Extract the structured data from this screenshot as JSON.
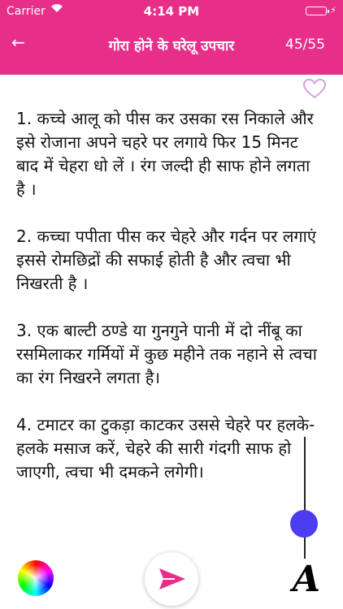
{
  "status_bar": {
    "carrier": "Carrier",
    "time": "4:14 PM"
  },
  "navbar": {
    "back_icon": "back-arrow-icon",
    "title": "गोरा होने के घरेलू उपचार",
    "counter": "45/55"
  },
  "colors": {
    "accent": "#e72f8a",
    "slider": "#4b3df0",
    "heart": "#d5a0e0"
  },
  "content": {
    "paragraphs": [
      "1. कच्चे आलू को पीस कर उसका रस निकाले और इसे रोजाना अपने चहरे पर लगाये फिर 15 मिनट बाद में चेहरा धो लें । रंग जल्दी ही साफ होने लगता है ।",
      "2. कच्चा पपीता पीस कर चेहरे और गर्दन पर लगाएं इससे रोमछिद्रों की सफाई होती है और त्वचा भी निखरती है ।",
      "3. एक बाल्टी ठण्डे या गुनगुने पानी में दो नींबू का रसमिलाकर गर्मियों में कुछ महीने तक नहाने से त्वचा का रंग निखरने लगता है।",
      "4. टमाटर का टुकड़ा काटकर उससे चेहरे पर हलके-हलके मसाज करें, चेहरे की सारी गंदगी साफ हो जाएगी, त्वचा भी दमकने लगेगी।"
    ]
  },
  "toolbar": {
    "font_label": "A"
  }
}
